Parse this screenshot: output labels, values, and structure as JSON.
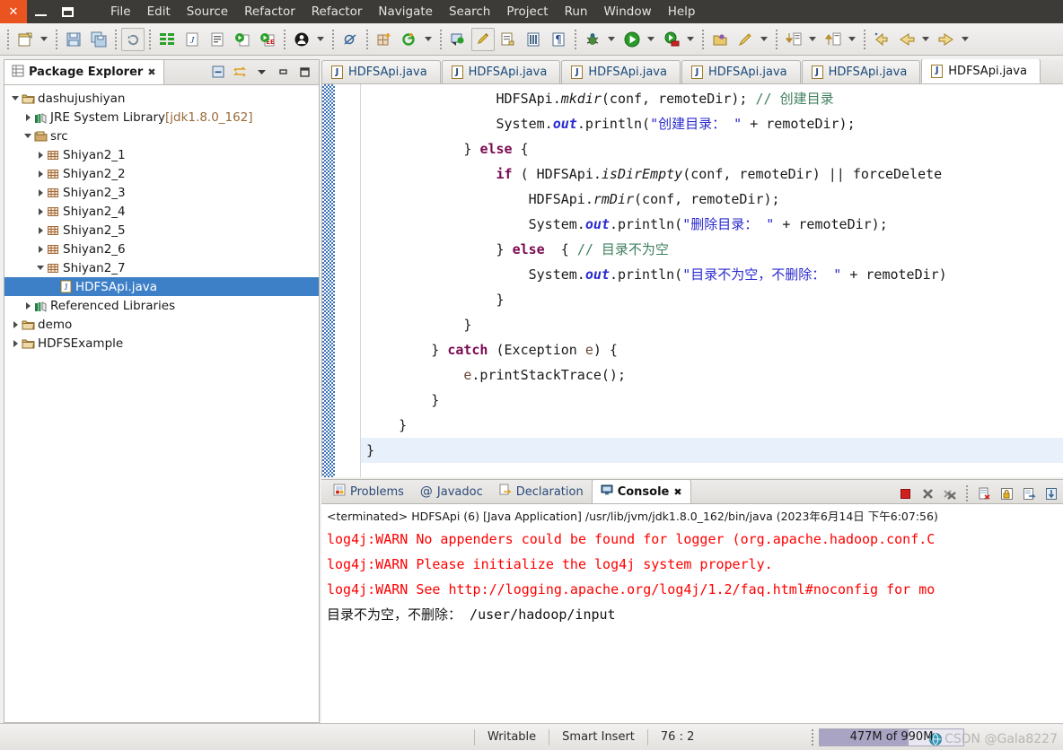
{
  "window": {
    "controls": [
      {
        "name": "close",
        "glyph": "×"
      },
      {
        "name": "minimize",
        "glyph": "–"
      },
      {
        "name": "maximize",
        "glyph": "□"
      }
    ]
  },
  "menubar": {
    "items": [
      "File",
      "Edit",
      "Source",
      "Refactor",
      "Refactor",
      "Navigate",
      "Search",
      "Project",
      "Run",
      "Window",
      "Help"
    ]
  },
  "toolbar": {
    "groups": [
      [
        "new-wizard-icon",
        "new-dropdown-caret"
      ],
      [
        "save-icon",
        "save-all-icon"
      ],
      [
        "refresh-icon"
      ],
      [
        "build-all-icon",
        "java-element-icon",
        "open-task-icon"
      ],
      [
        "run-last-tool-icon",
        "external-tools-icon"
      ],
      [
        "profile-icon",
        "profile-caret"
      ],
      [
        "skip-breakpoints-icon"
      ],
      [
        "new-java-project-icon",
        "new-package-icon",
        "new-package-caret"
      ],
      [
        "open-type-icon",
        "toggle-mark-occurrences-icon",
        "next-annotation-icon",
        "show-whitespace-icon",
        "paragraph-icon"
      ],
      [
        "debug-icon",
        "debug-caret",
        "run-icon",
        "run-caret",
        "run-config-icon",
        "run-config-caret"
      ],
      [
        "open-resource-icon",
        "search-icon",
        "search-caret"
      ],
      [
        "step-into-icon",
        "step-into-caret",
        "step-return-icon",
        "step-return-caret"
      ],
      [
        "back-history-icon",
        "back-icon",
        "back-caret",
        "forward-icon",
        "forward-caret"
      ]
    ]
  },
  "package_explorer": {
    "title": "Package Explorer",
    "close_glyph": "✖",
    "view_tools": [
      "collapse-all-icon",
      "link-with-editor-icon",
      "view-menu-icon",
      "minimize-icon",
      "maximize-icon"
    ],
    "tree": [
      {
        "label": "dashujushiyan",
        "sub": "",
        "depth": 0,
        "state": "open",
        "icon": "project-icon",
        "selected": false
      },
      {
        "label": "JRE System Library",
        "sub": " [jdk1.8.0_162]",
        "depth": 1,
        "state": "closed",
        "icon": "library-icon",
        "selected": false
      },
      {
        "label": "src",
        "sub": "",
        "depth": 1,
        "state": "open",
        "icon": "source-folder-icon",
        "selected": false
      },
      {
        "label": "Shiyan2_1",
        "sub": "",
        "depth": 2,
        "state": "closed",
        "icon": "package-icon",
        "selected": false
      },
      {
        "label": "Shiyan2_2",
        "sub": "",
        "depth": 2,
        "state": "closed",
        "icon": "package-icon",
        "selected": false
      },
      {
        "label": "Shiyan2_3",
        "sub": "",
        "depth": 2,
        "state": "closed",
        "icon": "package-icon",
        "selected": false
      },
      {
        "label": "Shiyan2_4",
        "sub": "",
        "depth": 2,
        "state": "closed",
        "icon": "package-icon",
        "selected": false
      },
      {
        "label": "Shiyan2_5",
        "sub": "",
        "depth": 2,
        "state": "closed",
        "icon": "package-icon",
        "selected": false
      },
      {
        "label": "Shiyan2_6",
        "sub": "",
        "depth": 2,
        "state": "closed",
        "icon": "package-icon",
        "selected": false
      },
      {
        "label": "Shiyan2_7",
        "sub": "",
        "depth": 2,
        "state": "open",
        "icon": "package-icon",
        "selected": false
      },
      {
        "label": "HDFSApi.java",
        "sub": "",
        "depth": 3,
        "state": "leaf",
        "icon": "java-file-icon",
        "selected": true
      },
      {
        "label": "Referenced Libraries",
        "sub": "",
        "depth": 1,
        "state": "closed",
        "icon": "library-icon",
        "selected": false
      },
      {
        "label": "demo",
        "sub": "",
        "depth": 0,
        "state": "closed",
        "icon": "project-icon",
        "selected": false
      },
      {
        "label": "HDFSExample",
        "sub": "",
        "depth": 0,
        "state": "closed",
        "icon": "project-icon",
        "selected": false
      }
    ]
  },
  "editor": {
    "tabs": [
      {
        "label": "HDFSApi.java",
        "active": false
      },
      {
        "label": "HDFSApi.java",
        "active": false
      },
      {
        "label": "HDFSApi.java",
        "active": false
      },
      {
        "label": "HDFSApi.java",
        "active": false
      },
      {
        "label": "HDFSApi.java",
        "active": false
      },
      {
        "label": "HDFSApi.java",
        "active": true
      }
    ],
    "lines": [
      {
        "highlight": false,
        "tokens": [
          {
            "t": "plain",
            "v": "                HDFSApi."
          },
          {
            "t": "method",
            "v": "mkdir"
          },
          {
            "t": "plain",
            "v": "(conf, remoteDir); "
          },
          {
            "t": "comment",
            "v": "// 创建目录"
          }
        ]
      },
      {
        "highlight": false,
        "tokens": [
          {
            "t": "plain",
            "v": "                System."
          },
          {
            "t": "field",
            "v": "out"
          },
          {
            "t": "plain",
            "v": ".println("
          },
          {
            "t": "string",
            "v": "\"创建目录： \""
          },
          {
            "t": "plain",
            "v": " + remoteDir);"
          }
        ]
      },
      {
        "highlight": false,
        "tokens": [
          {
            "t": "plain",
            "v": "            } "
          },
          {
            "t": "keyword",
            "v": "else"
          },
          {
            "t": "plain",
            "v": " {"
          }
        ]
      },
      {
        "highlight": false,
        "tokens": [
          {
            "t": "plain",
            "v": "                "
          },
          {
            "t": "keyword",
            "v": "if"
          },
          {
            "t": "plain",
            "v": " ( HDFSApi."
          },
          {
            "t": "method",
            "v": "isDirEmpty"
          },
          {
            "t": "plain",
            "v": "(conf, remoteDir) || forceDelete"
          }
        ]
      },
      {
        "highlight": false,
        "tokens": [
          {
            "t": "plain",
            "v": "                    HDFSApi."
          },
          {
            "t": "method",
            "v": "rmDir"
          },
          {
            "t": "plain",
            "v": "(conf, remoteDir);"
          }
        ]
      },
      {
        "highlight": false,
        "tokens": [
          {
            "t": "plain",
            "v": "                    System."
          },
          {
            "t": "field",
            "v": "out"
          },
          {
            "t": "plain",
            "v": ".println("
          },
          {
            "t": "string",
            "v": "\"删除目录： \""
          },
          {
            "t": "plain",
            "v": " + remoteDir);"
          }
        ]
      },
      {
        "highlight": false,
        "tokens": [
          {
            "t": "plain",
            "v": "                } "
          },
          {
            "t": "keyword",
            "v": "else"
          },
          {
            "t": "plain",
            "v": "  { "
          },
          {
            "t": "comment",
            "v": "// 目录不为空"
          }
        ]
      },
      {
        "highlight": false,
        "tokens": [
          {
            "t": "plain",
            "v": "                    System."
          },
          {
            "t": "field",
            "v": "out"
          },
          {
            "t": "plain",
            "v": ".println("
          },
          {
            "t": "string",
            "v": "\"目录不为空，不删除： \""
          },
          {
            "t": "plain",
            "v": " + remoteDir)"
          }
        ]
      },
      {
        "highlight": false,
        "tokens": [
          {
            "t": "plain",
            "v": "                }"
          }
        ]
      },
      {
        "highlight": false,
        "tokens": [
          {
            "t": "plain",
            "v": "            }"
          }
        ]
      },
      {
        "highlight": false,
        "tokens": [
          {
            "t": "plain",
            "v": "        } "
          },
          {
            "t": "keyword",
            "v": "catch"
          },
          {
            "t": "plain",
            "v": " (Exception "
          },
          {
            "t": "var",
            "v": "e"
          },
          {
            "t": "plain",
            "v": ") {"
          }
        ]
      },
      {
        "highlight": false,
        "tokens": [
          {
            "t": "plain",
            "v": "            "
          },
          {
            "t": "var",
            "v": "e"
          },
          {
            "t": "plain",
            "v": ".printStackTrace();"
          }
        ]
      },
      {
        "highlight": false,
        "tokens": [
          {
            "t": "plain",
            "v": "        }"
          }
        ]
      },
      {
        "highlight": false,
        "tokens": [
          {
            "t": "plain",
            "v": "    }"
          }
        ]
      },
      {
        "highlight": true,
        "tokens": [
          {
            "t": "plain",
            "v": "}"
          }
        ]
      }
    ]
  },
  "bottom_panel": {
    "tabs": [
      {
        "label": "Problems",
        "icon": "problems-icon",
        "active": false
      },
      {
        "label": "Javadoc",
        "icon": "javadoc-icon",
        "active": false
      },
      {
        "label": "Declaration",
        "icon": "declaration-icon",
        "active": false
      },
      {
        "label": "Console",
        "icon": "console-icon",
        "active": true
      }
    ],
    "close_glyph": "✖",
    "tools": [
      "terminate-icon",
      "remove-launch-icon",
      "remove-all-launches-icon",
      "clear-console-icon",
      "scroll-lock-icon",
      "pin-console-icon",
      "display-console-icon"
    ],
    "console": {
      "launch_header": "<terminated> HDFSApi (6) [Java Application] /usr/lib/jvm/jdk1.8.0_162/bin/java (2023年6月14日 下午6:07:56)",
      "output": [
        {
          "text": "log4j:WARN No appenders could be found for logger (org.apache.hadoop.conf.C",
          "error": true
        },
        {
          "text": "log4j:WARN Please initialize the log4j system properly.",
          "error": true
        },
        {
          "text": "log4j:WARN See http://logging.apache.org/log4j/1.2/faq.html#noconfig for mo",
          "error": true
        },
        {
          "text": "目录不为空，不删除： /user/hadoop/input",
          "error": false
        }
      ]
    }
  },
  "status_bar": {
    "writable": "Writable",
    "insert_mode": "Smart Insert",
    "cursor_position": "76 : 2",
    "memory": "477M of 990M",
    "watermark": "CSDN @Gala8227"
  },
  "colors": {
    "selection_blue": "#3d80c8",
    "error_red": "#ff0000",
    "keyword_purple": "#7a0a52",
    "string_blue": "#2a2ad0",
    "comment_green": "#3f7f5f",
    "titlebar": "#3c3b37",
    "close_orange": "#e95420"
  }
}
